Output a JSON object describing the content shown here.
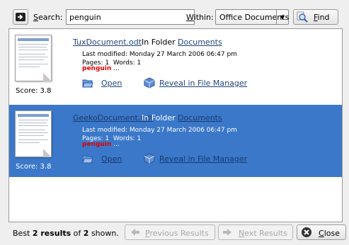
{
  "toolbar": {
    "search_label": "Search:",
    "search_value": "penguin",
    "within_label": "Within:",
    "within_value": "Office Documents",
    "find_label": "Find"
  },
  "results": [
    {
      "filename": "TuxDocument.odt",
      "in_folder": "In Folder",
      "folder": "Documents",
      "last_modified": "Last modified: Monday 27 March 2006 06:47 pm",
      "stats": "Pages: 1  Words: 1",
      "snippet_term": "penguin",
      "snippet_rest": " ...",
      "score": "Score: 3.8",
      "open_label": "Open",
      "reveal_label": "Reveal in File Manager",
      "selected": false
    },
    {
      "filename": "GeekoDocument.odt",
      "in_folder": "In Folder",
      "folder": "Documents",
      "last_modified": "Last modified: Monday 27 March 2006 06:47 pm",
      "stats": "Pages: 1  Words: 1",
      "snippet_term": "penguin",
      "snippet_rest": " ...",
      "score": "Score: 3.8",
      "open_label": "Open",
      "reveal_label": "Reveal in File Manager",
      "selected": true
    }
  ],
  "status": {
    "prefix": "Best ",
    "count": "2 results",
    "middle": " of ",
    "total": "2",
    "suffix": " shown."
  },
  "footer": {
    "previous_label": "Previous Results",
    "next_label": "Next Results",
    "close_label": "Close"
  },
  "icons": {
    "search_toggle": "run-arrow-icon",
    "find": "magnifier-icon",
    "open": "open-folder-icon",
    "reveal": "file-manager-icon",
    "previous": "arrow-left-icon",
    "next": "arrow-right-icon",
    "close": "close-icon"
  },
  "colors": {
    "selection": "#3b78c9",
    "link": "#23457a",
    "highlight": "#e00000"
  }
}
